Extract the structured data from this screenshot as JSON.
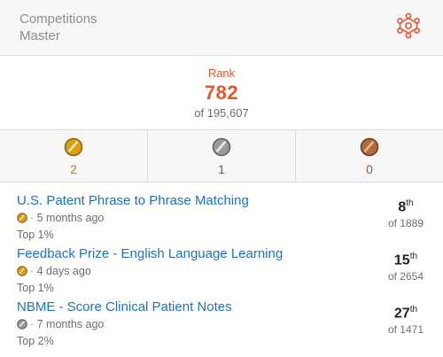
{
  "header": {
    "category": "Competitions",
    "tier": "Master",
    "tier_icon": "competitions-icon",
    "accent_color": "#e4572e"
  },
  "rank": {
    "label": "Rank",
    "value": "782",
    "total": "of 195,607"
  },
  "medals": [
    {
      "kind": "gold",
      "count": "2",
      "icon": "gold-medal-icon"
    },
    {
      "kind": "silver",
      "count": "1",
      "icon": "silver-medal-icon"
    },
    {
      "kind": "bronze",
      "count": "0",
      "icon": "bronze-medal-icon"
    }
  ],
  "competitions": [
    {
      "title": "U.S. Patent Phrase to Phrase Matching",
      "medal": "gold",
      "time": "· 5 months ago",
      "top": "Top 1%",
      "place": "8",
      "suffix": "th",
      "of": "of 1889"
    },
    {
      "title": "Feedback Prize - English Language Learning",
      "medal": "gold",
      "time": "· 4 days ago",
      "top": "Top 1%",
      "place": "15",
      "suffix": "th",
      "of": "of 2654"
    },
    {
      "title": "NBME - Score Clinical Patient Notes",
      "medal": "silver",
      "time": "· 7 months ago",
      "top": "Top 2%",
      "place": "27",
      "suffix": "th",
      "of": "of 1471"
    }
  ]
}
